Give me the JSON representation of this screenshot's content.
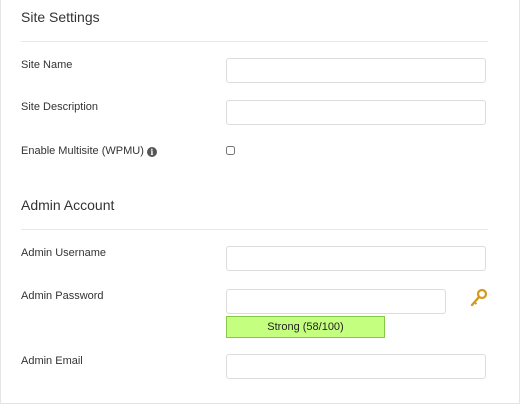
{
  "site_settings": {
    "heading": "Site Settings",
    "site_name_label": "Site Name",
    "site_name_value": "",
    "site_description_label": "Site Description",
    "site_description_value": "",
    "multisite_label": "Enable Multisite (WPMU)",
    "multisite_checked": false,
    "info_icon": "info-icon"
  },
  "admin_account": {
    "heading": "Admin Account",
    "username_label": "Admin Username",
    "username_value": "",
    "password_label": "Admin Password",
    "password_value": "",
    "password_strength": "Strong (58/100)",
    "strength_color": "#c4ff80",
    "generate_icon": "key-icon",
    "email_label": "Admin Email",
    "email_value": ""
  }
}
